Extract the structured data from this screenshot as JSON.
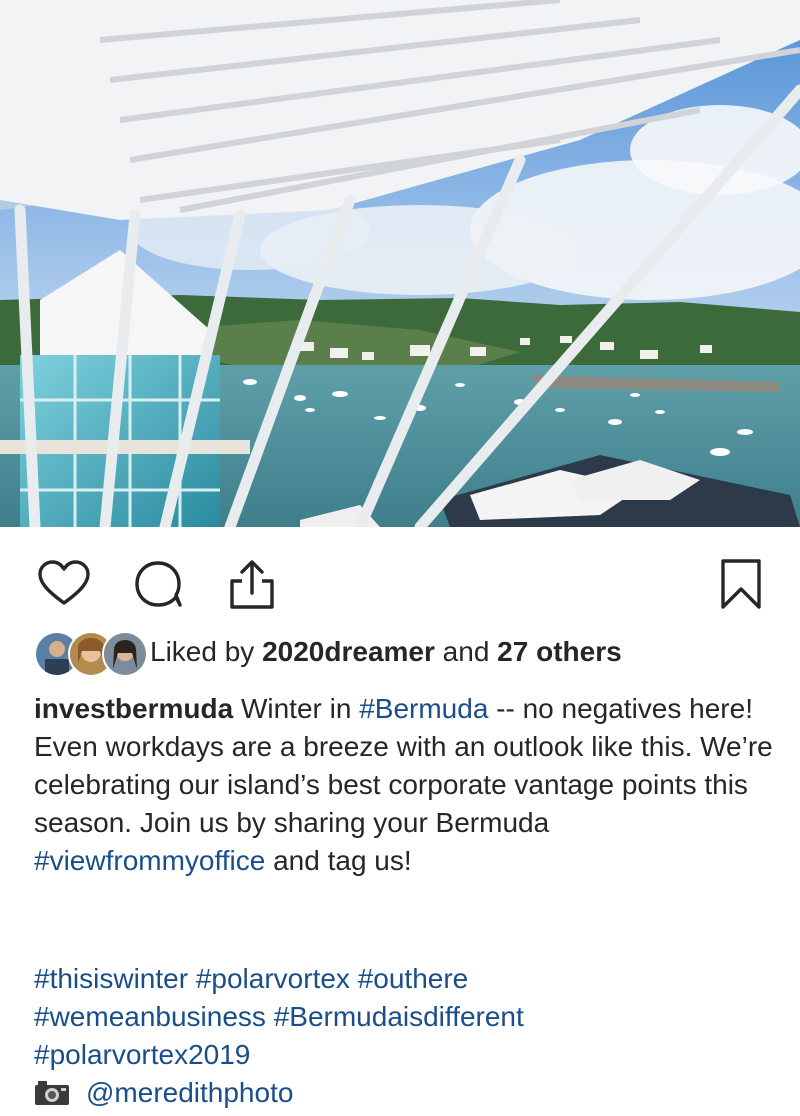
{
  "post": {
    "image_alt": "View from office balcony over Bermuda harbor with boats and white pergola",
    "likes": {
      "prefix": "Liked by ",
      "user": "2020dreamer",
      "middle": " and ",
      "others": "27 others"
    },
    "caption": {
      "username": "invest​bermuda",
      "seg1": " Winter in ",
      "tag1": "#Bermuda",
      "seg2": " -- no negatives here! Even workdays are a breeze with an outlook like this. We’re celebrating our island’s best corporate vantage points this season. Join us by sharing your Bermuda ",
      "tag2": "#viewfrommyoffice",
      "seg3": " and tag us!"
    },
    "hashtag_lines": [
      [
        "#thisiswinter",
        "#polarvortex",
        "#outhere"
      ],
      [
        "#wemeanbusiness",
        "#Bermudaisdifferent"
      ],
      [
        "#polarvortex2019"
      ]
    ],
    "credit": "@meredithphoto",
    "icons": {
      "like": "heart-icon",
      "comment": "comment-icon",
      "share": "share-icon",
      "save": "bookmark-icon",
      "credit": "camera-icon"
    },
    "colors": {
      "text": "#262626",
      "hashtag": "#1a4e8a"
    }
  }
}
